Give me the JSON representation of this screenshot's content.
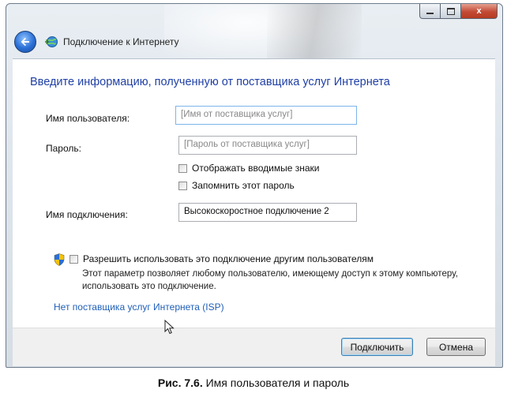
{
  "window": {
    "title": "Подключение к Интернету",
    "close_glyph": "x"
  },
  "heading": "Введите информацию, полученную от поставщика услуг Интернета",
  "form": {
    "username_label": "Имя пользователя:",
    "username_placeholder": "[Имя от поставщика услуг]",
    "password_label": "Пароль:",
    "password_placeholder": "[Пароль от поставщика услуг]",
    "show_chars_label": "Отображать вводимые знаки",
    "remember_label": "Запомнить этот пароль",
    "connection_name_label": "Имя подключения:",
    "connection_name_value": "Высокоскоростное подключение 2"
  },
  "sharing": {
    "allow_label": "Разрешить использовать это подключение другим пользователям",
    "description_line1": "Этот параметр позволяет любому пользователю, имеющему доступ к этому компьютеру,",
    "description_line2": "использовать это подключение."
  },
  "link": "Нет поставщика услуг Интернета (ISP)",
  "buttons": {
    "connect": "Подключить",
    "cancel": "Отмена"
  },
  "figure_caption": {
    "number": "Рис. 7.6.",
    "text": " Имя пользователя и пароль"
  },
  "icons": [
    "back-arrow-icon",
    "network-globe-icon",
    "uac-shield-icon",
    "mouse-cursor-icon"
  ],
  "colors": {
    "heading": "#1f3fa6",
    "link": "#1f5fb8",
    "close_button": "#c24a34",
    "back_button": "#2a6fd6"
  }
}
